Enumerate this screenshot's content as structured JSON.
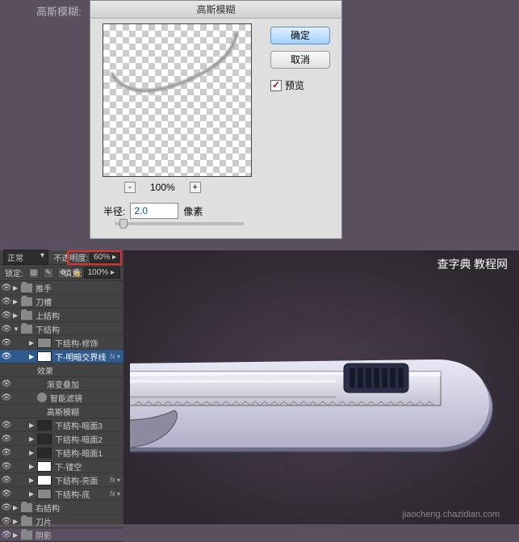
{
  "top": {
    "label": "高斯模糊:",
    "dialog_title": "高斯模糊",
    "zoom": "100%",
    "radius_label": "半径:",
    "radius_value": "2.0",
    "radius_unit": "像素",
    "ok": "确定",
    "cancel": "取消",
    "preview": "预览"
  },
  "panel": {
    "blend": "正常",
    "opacity_label": "不透明度:",
    "opacity": "60%",
    "lock_label": "锁定:",
    "fill_label": "填充:",
    "fill": "100%"
  },
  "layers": [
    {
      "name": "推手",
      "type": "folder",
      "indent": 0
    },
    {
      "name": "刀槽",
      "type": "folder",
      "indent": 0
    },
    {
      "name": "上结构",
      "type": "folder",
      "indent": 0
    },
    {
      "name": "下结构",
      "type": "folder",
      "indent": 0,
      "open": true
    },
    {
      "name": "下结构-修饰",
      "type": "layer",
      "indent": 2,
      "thumb": "grey"
    },
    {
      "name": "下-明暗交界线",
      "type": "layer",
      "indent": 2,
      "sel": true,
      "fx": true,
      "thumb": "white",
      "chev": true
    },
    {
      "name": "效果",
      "type": "sub",
      "indent": 3
    },
    {
      "name": "渐变叠加",
      "type": "sub",
      "indent": 4,
      "eye": true
    },
    {
      "name": "智能滤镜",
      "type": "sub",
      "indent": 3,
      "eye": true,
      "filter": true
    },
    {
      "name": "高斯模糊",
      "type": "sub",
      "indent": 4
    },
    {
      "name": "下结构-暗面3",
      "type": "layer",
      "indent": 2,
      "thumb": "dark"
    },
    {
      "name": "下结构-暗面2",
      "type": "layer",
      "indent": 2,
      "thumb": "dark"
    },
    {
      "name": "下结构-暗面1",
      "type": "layer",
      "indent": 2,
      "thumb": "dark"
    },
    {
      "name": "下-镂空",
      "type": "layer",
      "indent": 2,
      "thumb": "white"
    },
    {
      "name": "下结构-亮面",
      "type": "layer",
      "indent": 2,
      "thumb": "white",
      "fx": true,
      "chev": true
    },
    {
      "name": "下结构-底",
      "type": "layer",
      "indent": 2,
      "thumb": "grey",
      "fx": true,
      "chev": true
    },
    {
      "name": "右结构",
      "type": "folder",
      "indent": 0
    },
    {
      "name": "刀片",
      "type": "folder",
      "indent": 0
    },
    {
      "name": "阴影",
      "type": "folder",
      "indent": 0
    }
  ],
  "wm": {
    "a": "查字典",
    "b": "教程网",
    "url": "jiaocheng.chazidian.com"
  }
}
